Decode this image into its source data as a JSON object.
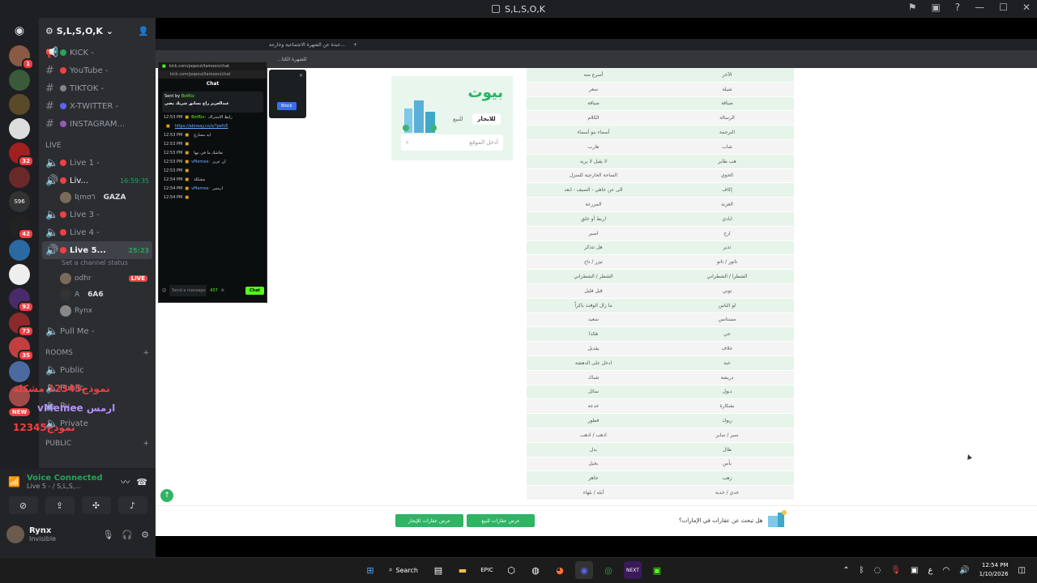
{
  "window": {
    "title": "S,L,S,O,K",
    "controls": [
      "flag",
      "screen",
      "help",
      "minimize",
      "maximize",
      "close"
    ]
  },
  "server": {
    "name": "S,L,S,O,K",
    "home_icon": "discord-icon",
    "rail_badges": [
      "1",
      "",
      "",
      "",
      "32",
      "",
      "S96",
      "42",
      "",
      "",
      "92",
      "73",
      "35",
      "",
      "",
      "NEW"
    ]
  },
  "channels": {
    "text": [
      {
        "name": "KICK -",
        "color": "#23a55a"
      },
      {
        "name": "YouTube -",
        "color": "#f23f43"
      },
      {
        "name": "TIKTOK -",
        "color": "#80848e"
      },
      {
        "name": "X-TWITTER -",
        "color": "#5865f2"
      },
      {
        "name": "INSTAGRAM...",
        "color": "#9b59b6"
      }
    ],
    "live_category": "Live",
    "voice": [
      {
        "name": "Live 1 -"
      },
      {
        "name": "Liv...",
        "timer": "16:59:35",
        "sub_member": "Ʀmσ٦",
        "sub_tag": "GAZA"
      },
      {
        "name": "Live 3 -"
      },
      {
        "name": "Live 4 -"
      },
      {
        "name": "Live 5...",
        "timer": "25:23",
        "status": "Set a channel status"
      }
    ],
    "live5_members": [
      {
        "name": "odhr",
        "live": "LIVE"
      },
      {
        "name": "A",
        "tag": "6A6"
      },
      {
        "name": "Rynx"
      }
    ],
    "pull_me": "Pull Me -",
    "rooms_category": "ROOMS",
    "rooms": [
      "Public",
      "Public",
      "Pu...",
      "Private"
    ],
    "public_category": "PUBLIC"
  },
  "overlay_names": [
    {
      "text": "نموذج12345 مشكلة",
      "color": "#f23f43"
    },
    {
      "text": "vMemee ارمس",
      "color": "#9b59ff"
    },
    {
      "text": "نموذج12345",
      "color": "#f23f43"
    }
  ],
  "voice_panel": {
    "title": "Voice Connected",
    "subtitle": "Live 5 - / S,L,S,...",
    "user": "Rynx",
    "status": "Invisible"
  },
  "browser": {
    "tab1": "عبدة عن الشهرة الاجتماعية وخارجة...",
    "address": "...للشهرة الكتا"
  },
  "kick": {
    "url": "kick.com/popout/lamoon/chat",
    "title": "Chat",
    "pinned_by": "Sent by",
    "pinned_user": "BotRix",
    "pinned_text": "عبدالعزيز راح يسابق شريك يضي",
    "messages": [
      {
        "time": "12:53 PM",
        "user": "BotRix:",
        "text": "رابط الاشتراك"
      },
      {
        "time": "",
        "user": "",
        "text": "https://abneay.co/s/?pefcE"
      },
      {
        "time": "12:53 PM",
        "user": "",
        "text": "ايه مسارع"
      },
      {
        "time": "12:53 PM",
        "user": "",
        "text": ""
      },
      {
        "time": "12:53 PM",
        "user": "",
        "text": "نقاشك ما في بيها"
      },
      {
        "time": "12:53 PM",
        "user": "vMemee:",
        "text": "ان عزيز"
      },
      {
        "time": "12:53 PM",
        "user": "",
        "text": ""
      },
      {
        "time": "12:54 PM",
        "user": "",
        "text": "مشكلة"
      },
      {
        "time": "12:54 PM",
        "user": "vMemee:",
        "text": "ارمس"
      },
      {
        "time": "12:54 PM",
        "user": "",
        "text": ""
      }
    ],
    "input_placeholder": "Send a message",
    "viewer_count": "437",
    "chat_button": "Chat",
    "block_button": "Block"
  },
  "site": {
    "logo": "بيوت",
    "tab_rent": "للايجار",
    "tab_sale": "للبيع",
    "search_placeholder": "أدخل الموقع",
    "rows": [
      [
        "أسرع منه",
        "الآخر"
      ],
      [
        "سعر",
        "شيلة"
      ],
      [
        "ضيافة",
        "ضيافة"
      ],
      [
        "الكلام",
        "الرسالة"
      ],
      [
        "أسماء بنو أسماء",
        "الترجمة"
      ],
      [
        "هارب",
        "شاب"
      ],
      [
        "لا يقبل لا يريد",
        "هب طاير"
      ],
      [
        "الساحة الخارجية للمنزل",
        "الحوي"
      ],
      [
        "الى عن جاهي - الصيف - ابعد",
        "إكاف"
      ],
      [
        "المزرعة",
        "العزبة"
      ],
      [
        "اربط أو خلق",
        "ابادي"
      ],
      [
        "اسير",
        "ارح"
      ],
      [
        "هل تتذكر",
        "تذير"
      ],
      [
        "تيزر / تاح",
        "تاتور / تاتو"
      ],
      [
        "الشطر / الشطراني",
        "الشطرا / الشطراني"
      ],
      [
        "قبل قليل",
        "توني"
      ],
      [
        "ما زال الوقت باكراً",
        "لو الناس"
      ],
      [
        "سعيد",
        "مستانس"
      ],
      [
        "هكذا",
        "جي"
      ],
      [
        "يقديل",
        "خلاف"
      ],
      [
        "ادخل على الدهشة",
        "خبة"
      ],
      [
        "شباك",
        "دريشة"
      ],
      [
        "سائل",
        "ديول"
      ],
      [
        "خدعة",
        "بشكارة"
      ],
      [
        "فطور",
        "ريوك"
      ],
      [
        "اذهب / اذهب",
        "سير / سابر"
      ],
      [
        "بدل",
        "ظال"
      ],
      [
        "بخيل",
        "يأس"
      ],
      [
        "جاهز",
        "زهب"
      ],
      [
        "أبله / بلهاء",
        "خدي / خدبة"
      ]
    ],
    "footer_question": "هل تبحث عن عقارات في الإمارات؟",
    "btn_sale": "عرض عقارات للبيع",
    "btn_rent": "عرض عقارات للإيجار"
  },
  "taskbar": {
    "search": "Search",
    "time": "12:54 PM",
    "date": "1/10/2026",
    "lang": "ع"
  }
}
